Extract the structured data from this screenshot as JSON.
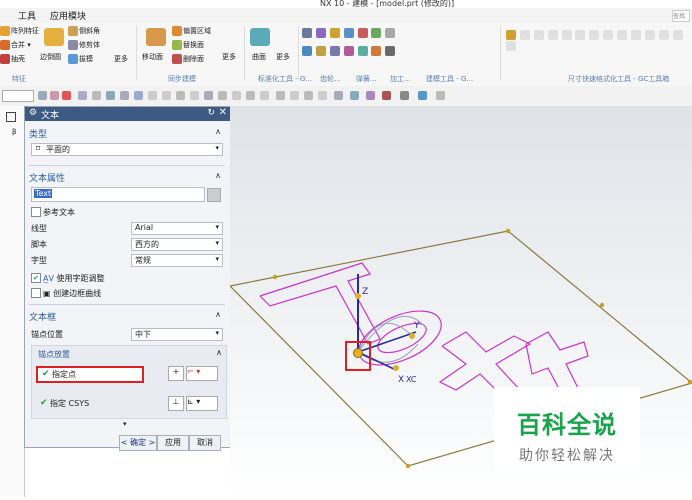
{
  "window": {
    "title": "NX 10 - 建模 - [model.prt (修改的)]"
  },
  "menu": {
    "items": [
      "工具",
      "应用模块"
    ],
    "search_hint": "查找"
  },
  "ribbon": {
    "left_items": [
      "阵列特征",
      "合并",
      "抽壳"
    ],
    "mid_items": [
      "倒斜角",
      "修剪体",
      "拔模"
    ],
    "big_edge": "边倒圆",
    "more1": "更多",
    "move_face": "移动面",
    "sync_items": [
      "偏置区域",
      "替换面",
      "删除面"
    ],
    "more2": "更多",
    "surface": "曲面",
    "more3": "更多",
    "groups": [
      "特征",
      "同步建模",
      "标准化工具 - G...",
      "齿轮...",
      "弹簧...",
      "加工...",
      "建模工具 - G...",
      "尺寸快速格式化工具 - GC工具箱"
    ]
  },
  "dialog": {
    "title": "文本",
    "sections": {
      "type": {
        "header": "类型",
        "value": "平面的"
      },
      "props": {
        "header": "文本属性",
        "text_value": "Text",
        "ref_text": "参考文本",
        "line_label": "线型",
        "line_value": "Arial",
        "script_label": "脚本",
        "script_value": "西方的",
        "style_label": "字型",
        "style_value": "常规",
        "kerning": "使用字距调整",
        "boundary": "创建边框曲线"
      },
      "box": {
        "header": "文本框",
        "anchor_label": "锚点位置",
        "anchor_value": "中下",
        "placement_header": "锚点放置",
        "specify_point": "指定点",
        "specify_csys": "指定 CSYS"
      }
    },
    "buttons": {
      "ok": "< 确定 >",
      "apply": "应用",
      "cancel": "取消"
    }
  },
  "viewport": {
    "axis_z": "Z",
    "axis_x": "X",
    "axis_y": "Y",
    "xc": "XC"
  },
  "watermark": {
    "main": "百科全说",
    "sub": "助你轻松解决"
  },
  "colors": {
    "accent": "#3c5a82",
    "curve": "#cc33cc",
    "highlight": "#e02020",
    "check": "#1aa040"
  }
}
